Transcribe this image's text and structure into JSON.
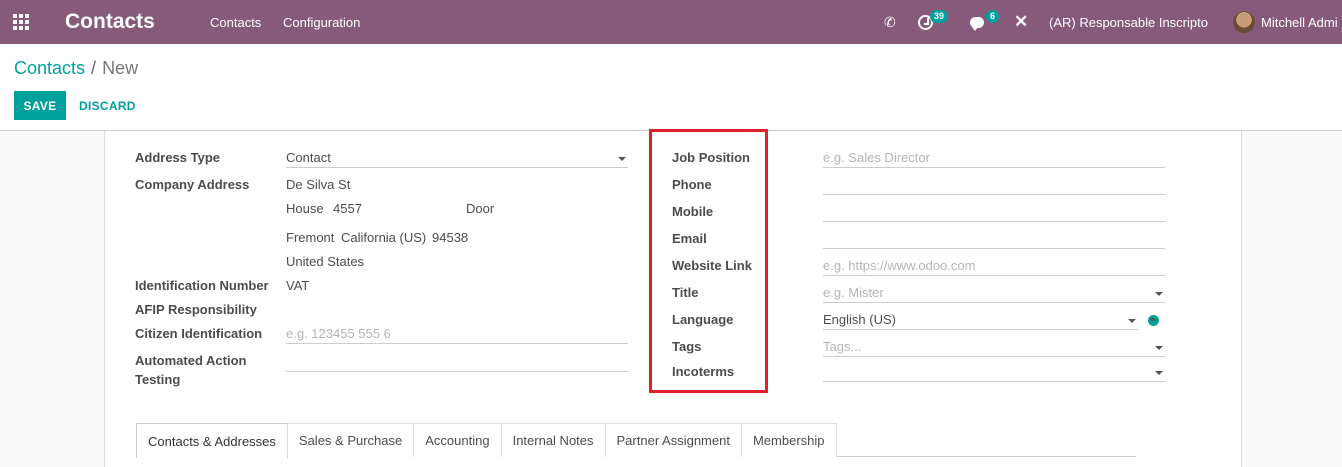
{
  "navbar": {
    "brand": "Contacts",
    "menu": [
      "Contacts",
      "Configuration"
    ],
    "activity_count": "39",
    "message_count": "6",
    "company": "(AR) Responsable Inscripto",
    "user": "Mitchell Admi",
    "icons": [
      "apps-icon",
      "phone-icon",
      "activity-icon",
      "chat-icon",
      "debug-icon"
    ]
  },
  "breadcrumb": {
    "parent": "Contacts",
    "separator": "/",
    "current": "New"
  },
  "actions": {
    "save": "SAVE",
    "discard": "DISCARD"
  },
  "form": {
    "left": {
      "address_type_label": "Address Type",
      "address_type_value": "Contact",
      "company_address_label": "Company Address",
      "street": "De Silva St",
      "house_label": "House",
      "house_number": "4557",
      "door_label": "Door",
      "city": "Fremont",
      "state": "California (US)",
      "zip": "94538",
      "country": "United States",
      "identification_label": "Identification Number",
      "identification_value": "VAT",
      "afip_label": "AFIP Responsibility",
      "citizen_label": "Citizen Identification",
      "citizen_placeholder": "e.g. 123455 555 6",
      "automated_label_1": "Automated Action",
      "automated_label_2": "Testing"
    },
    "right": {
      "job_position_label": "Job Position",
      "job_position_placeholder": "e.g. Sales Director",
      "phone_label": "Phone",
      "mobile_label": "Mobile",
      "email_label": "Email",
      "website_label": "Website Link",
      "website_placeholder": "e.g. https://www.odoo.com",
      "title_label": "Title",
      "title_placeholder": "e.g. Mister",
      "language_label": "Language",
      "language_value": "English (US)",
      "tags_label": "Tags",
      "tags_placeholder": "Tags...",
      "incoterms_label": "Incoterms"
    }
  },
  "tabs": [
    "Contacts & Addresses",
    "Sales & Purchase",
    "Accounting",
    "Internal Notes",
    "Partner Assignment",
    "Membership"
  ],
  "colors": {
    "navbar": "#875a7b",
    "accent": "#00a09d",
    "highlight": "#e0202a"
  }
}
